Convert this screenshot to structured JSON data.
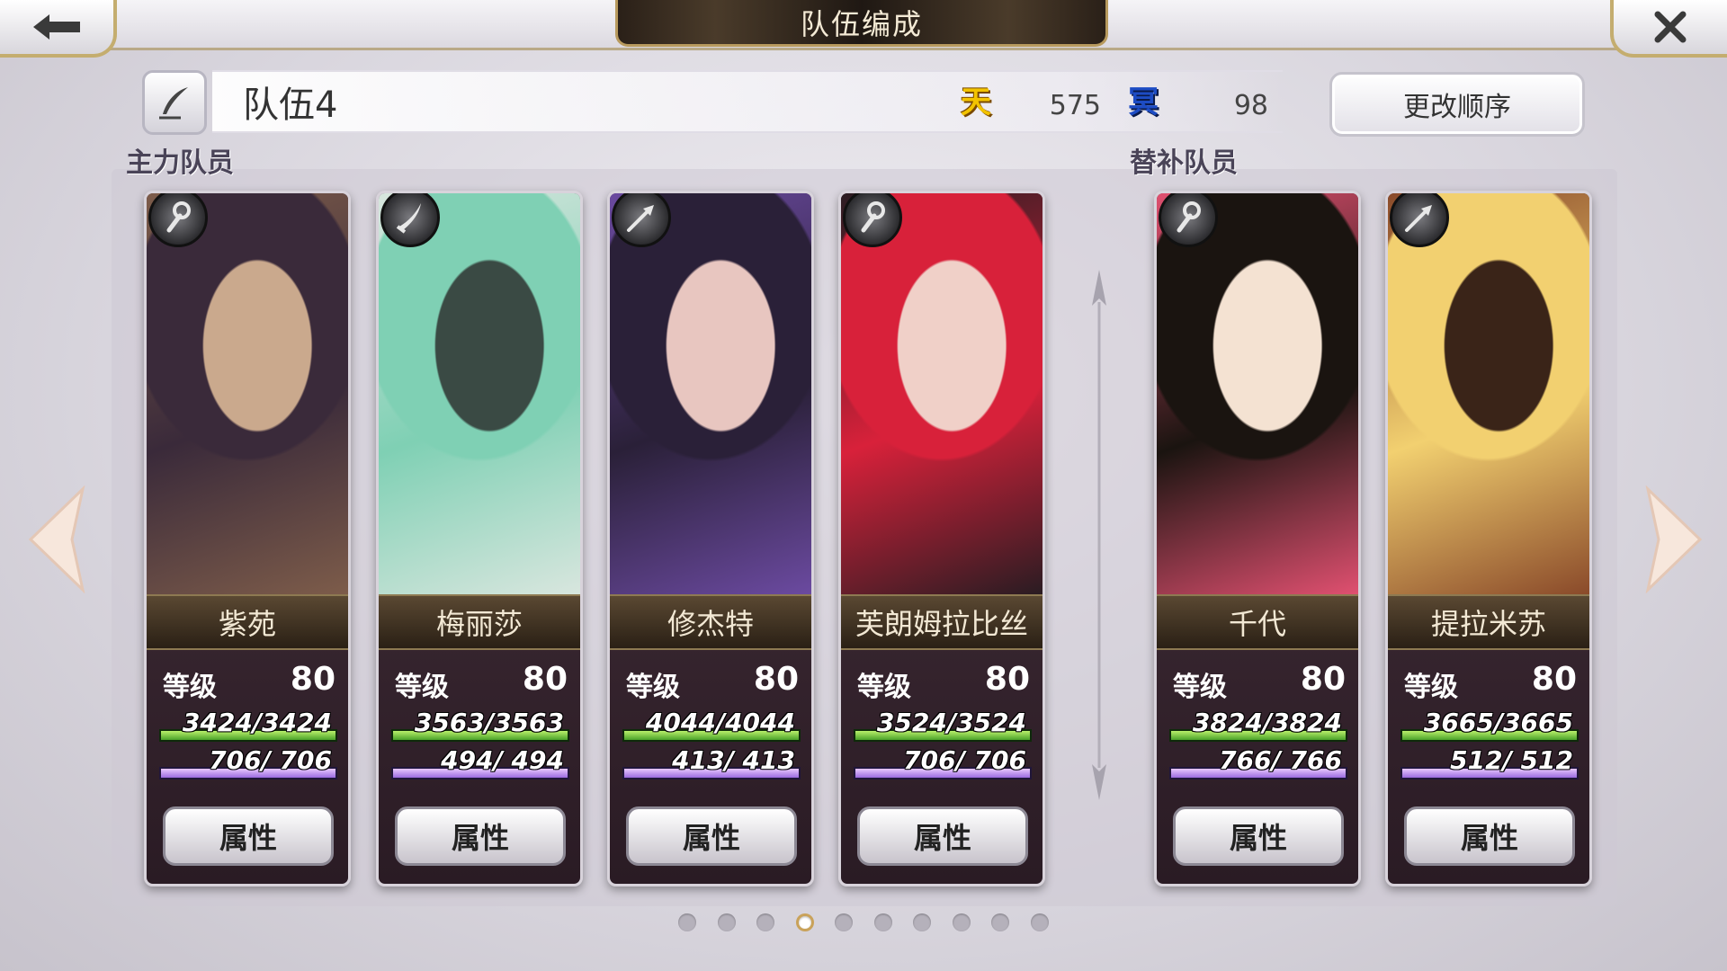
{
  "header": {
    "title": "队伍编成"
  },
  "team": {
    "name": "队伍4",
    "heaven_icon": "天",
    "heaven_value": "575",
    "dark_icon": "冥",
    "dark_value": "98",
    "order_button": "更改顺序"
  },
  "sections": {
    "main": "主力队员",
    "reserve": "替补队员"
  },
  "colors": {
    "hp": "#7cc63f",
    "mp": "#b48ae8",
    "gold_trim": "#c4ad6f"
  },
  "members": [
    {
      "name": "紫苑",
      "weapon": "staff-icon",
      "level_label": "等级",
      "level": "80",
      "hp": "3424/3424",
      "hp_ratio": 1.0,
      "mp": "706/ 706",
      "mp_ratio": 1.0,
      "attr": "属性",
      "palette": [
        "#3a2a3a",
        "#7d5c4a",
        "#caa98d"
      ]
    },
    {
      "name": "梅丽莎",
      "weapon": "blade-icon",
      "level_label": "等级",
      "level": "80",
      "hp": "3563/3563",
      "hp_ratio": 1.0,
      "mp": "494/ 494",
      "mp_ratio": 1.0,
      "attr": "属性",
      "palette": [
        "#7fd0b4",
        "#d8e6de",
        "#3a4a44"
      ]
    },
    {
      "name": "修杰特",
      "weapon": "arrow-icon",
      "level_label": "等级",
      "level": "80",
      "hp": "4044/4044",
      "hp_ratio": 1.0,
      "mp": "413/ 413",
      "mp_ratio": 1.0,
      "attr": "属性",
      "palette": [
        "#2a2038",
        "#6b4aa0",
        "#e8c6c0"
      ]
    },
    {
      "name": "芙朗姆拉比丝",
      "weapon": "staff-icon",
      "level_label": "等级",
      "level": "80",
      "hp": "3524/3524",
      "hp_ratio": 1.0,
      "mp": "706/ 706",
      "mp_ratio": 1.0,
      "attr": "属性",
      "palette": [
        "#d8213a",
        "#2a1c22",
        "#f0d0c8"
      ]
    },
    {
      "name": "千代",
      "weapon": "staff-icon",
      "level_label": "等级",
      "level": "80",
      "hp": "3824/3824",
      "hp_ratio": 1.0,
      "mp": "766/ 766",
      "mp_ratio": 1.0,
      "attr": "属性",
      "palette": [
        "#1a1410",
        "#e05070",
        "#f4e2d2"
      ]
    },
    {
      "name": "提拉米苏",
      "weapon": "arrow-icon",
      "level_label": "等级",
      "level": "80",
      "hp": "3665/3665",
      "hp_ratio": 1.0,
      "mp": "512/ 512",
      "mp_ratio": 1.0,
      "attr": "属性",
      "palette": [
        "#f2d070",
        "#8a4a2a",
        "#3a2418"
      ]
    }
  ],
  "pagination": {
    "total": 10,
    "current": 4
  }
}
